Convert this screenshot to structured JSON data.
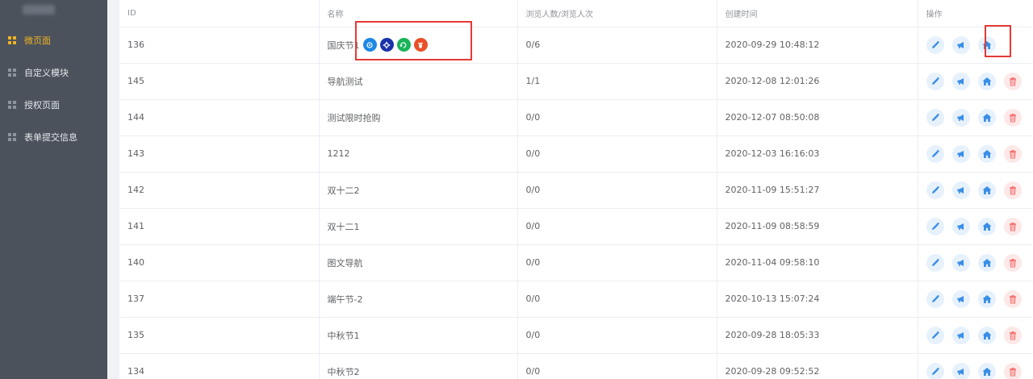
{
  "sidebar": {
    "items": [
      {
        "label": "微页面",
        "active": true
      },
      {
        "label": "自定义模块",
        "active": false
      },
      {
        "label": "授权页面",
        "active": false
      },
      {
        "label": "表单提交信息",
        "active": false
      }
    ]
  },
  "table": {
    "headers": {
      "id": "ID",
      "name": "名称",
      "views": "浏览人数/浏览人次",
      "created": "创建时间",
      "ops": "操作"
    },
    "rows": [
      {
        "id": "136",
        "name": "国庆节1",
        "views": "0/6",
        "created": "2020-09-29 10:48:12"
      },
      {
        "id": "145",
        "name": "导航测试",
        "views": "1/1",
        "created": "2020-12-08 12:01:26"
      },
      {
        "id": "144",
        "name": "测试限时抢购",
        "views": "0/0",
        "created": "2020-12-07 08:50:08"
      },
      {
        "id": "143",
        "name": "1212",
        "views": "0/0",
        "created": "2020-12-03 16:16:03"
      },
      {
        "id": "142",
        "name": "双十二2",
        "views": "0/0",
        "created": "2020-11-09 15:51:27"
      },
      {
        "id": "141",
        "name": "双十二1",
        "views": "0/0",
        "created": "2020-11-09 08:58:59"
      },
      {
        "id": "140",
        "name": "图文导航",
        "views": "0/0",
        "created": "2020-11-04 09:58:10"
      },
      {
        "id": "137",
        "name": "端午节-2",
        "views": "0/0",
        "created": "2020-10-13 15:07:24"
      },
      {
        "id": "135",
        "name": "中秋节1",
        "views": "0/0",
        "created": "2020-09-28 18:05:33"
      },
      {
        "id": "134",
        "name": "中秋节2",
        "views": "0/0",
        "created": "2020-09-28 09:52:52"
      }
    ]
  },
  "colors": {
    "accent": "#f0b323",
    "sidebar": "#4b525c",
    "op_blue": "#3a8ee6",
    "op_red": "#f56c6c",
    "highlight": "#e53935"
  },
  "icons": {
    "row_name_icons": [
      "link-icon",
      "gear-icon",
      "refresh-icon",
      "trash-icon"
    ],
    "row_ops": [
      "edit-icon",
      "megaphone-icon",
      "home-icon",
      "trash-icon"
    ]
  }
}
